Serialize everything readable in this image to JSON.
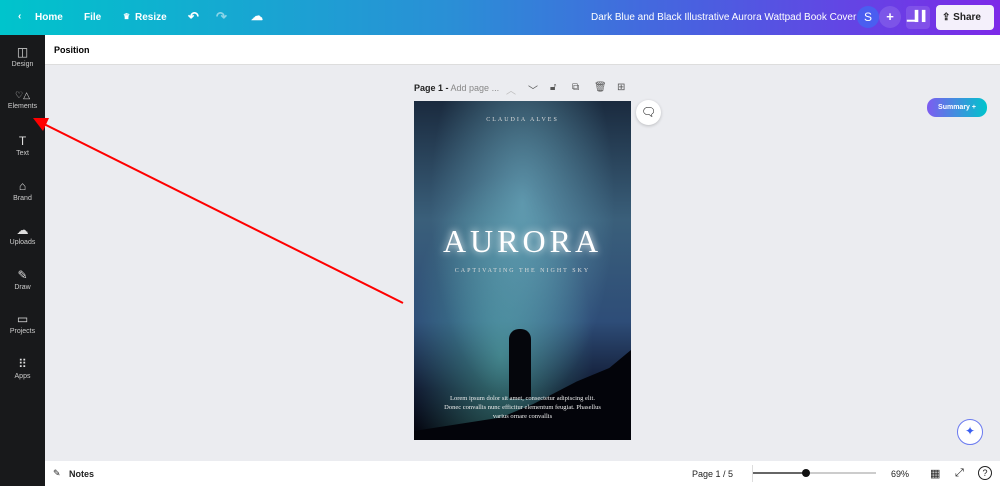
{
  "topbar": {
    "home": "Home",
    "file": "File",
    "resize": "Resize",
    "title": "Dark Blue and Black Illustrative Aurora Wattpad Book Cover",
    "avatar": "S",
    "share": "Share"
  },
  "sidebar": {
    "items": [
      {
        "label": "Design",
        "icon": "◫"
      },
      {
        "label": "Elements",
        "icon": "♡△"
      },
      {
        "label": "Text",
        "icon": "T"
      },
      {
        "label": "Brand",
        "icon": "⌂"
      },
      {
        "label": "Uploads",
        "icon": "☁"
      },
      {
        "label": "Draw",
        "icon": "✎"
      },
      {
        "label": "Projects",
        "icon": "▭"
      },
      {
        "label": "Apps",
        "icon": "⠿"
      }
    ]
  },
  "toolbar": {
    "position": "Position"
  },
  "page": {
    "label": "Page 1 -",
    "add_title": "Add page ..."
  },
  "cover": {
    "author": "CLAUDIA ALVES",
    "title": "AURORA",
    "subtitle": "CAPTIVATING THE NIGHT SKY",
    "body": "Lorem ipsum dolor sit amet, consectetur adipiscing elit. Donec convallis nunc efficitur elementum feugiat. Phasellus varius ornare convallis"
  },
  "summary": "Summary +",
  "footer": {
    "notes": "Notes",
    "page_count": "Page 1 / 5",
    "zoom": "69%",
    "zoom_value": 69
  },
  "annotation": {
    "arrow_color": "#ff0000"
  }
}
